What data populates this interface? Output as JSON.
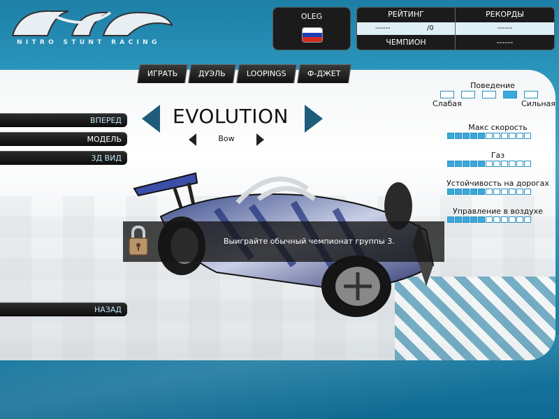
{
  "logo": {
    "subtitle": "NITRO STUNT RACING"
  },
  "player": {
    "name": "OLEG",
    "flag_colors": [
      "#ffffff",
      "#1c3fb5",
      "#d52b1e"
    ]
  },
  "stats": {
    "rating_label": "РЕЙТИНГ",
    "records_label": "РЕКОРДЫ",
    "rating_value": "------",
    "rating_suffix": "/0",
    "records_value": "------",
    "champion_label": "ЧЕМПИОН",
    "champion_value": "------"
  },
  "tabs": [
    "ИГРАТЬ",
    "ДУЭЛЬ",
    "LOOPINGS",
    "Ф-ДЖЕТ"
  ],
  "left_menu": {
    "forward": "ВПЕРЕД",
    "model": "МОДЕЛЬ",
    "view3d": "3Д ВИД",
    "back": "НАЗАД"
  },
  "car": {
    "title": "EVOLUTION",
    "model": "Bow"
  },
  "behavior": {
    "title": "Поведение",
    "weak": "Слабая",
    "strong": "Сильная",
    "level": 4,
    "steps": 5
  },
  "bars": [
    {
      "label": "Макс скорость",
      "value": 5,
      "max": 11
    },
    {
      "label": "Газ",
      "value": 5,
      "max": 11
    },
    {
      "label": "Устойчивость на дорогах",
      "value": 5,
      "max": 11
    },
    {
      "label": "Управление в воздухе",
      "value": 5,
      "max": 11
    }
  ],
  "lock": {
    "message": "Выиграйте обычный чемпионат группы 3."
  },
  "colors": {
    "accent": "#39a9dc",
    "dark": "#1b1b1b",
    "arrow": "#1f5b7a"
  }
}
